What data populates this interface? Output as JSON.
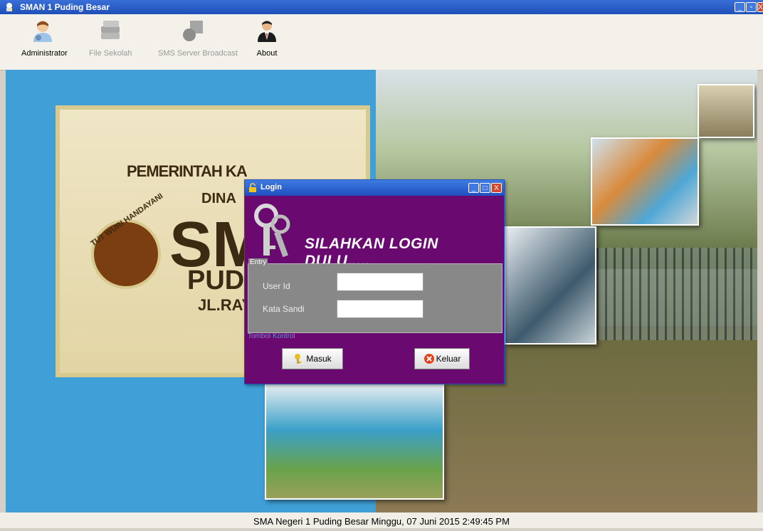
{
  "window": {
    "title": "SMAN 1 Puding Besar"
  },
  "toolbar": {
    "items": [
      {
        "label": "Administrator",
        "icon": "admin-user-icon",
        "enabled": true
      },
      {
        "label": "File Sekolah",
        "icon": "file-stack-icon",
        "enabled": false
      },
      {
        "label": "SMS Server Broadcast",
        "icon": "sms-server-icon",
        "enabled": false
      },
      {
        "label": "About",
        "icon": "person-suit-icon",
        "enabled": true
      }
    ]
  },
  "background": {
    "sign_lines": [
      "PEMERINTAH KA",
      "DINA",
      "SM",
      "PUDIN",
      "JL.RAYA"
    ],
    "emblem_text": "TUT WURI HANDAYANI"
  },
  "login": {
    "title": "Login",
    "headline": "SILAHKAN LOGIN DULU.....",
    "entry_legend": "Entry",
    "user_id_label": "User Id",
    "user_id_value": "",
    "password_label": "Kata Sandi",
    "password_value": "",
    "control_legend": "Tombol Kontrol",
    "login_button": "Masuk",
    "exit_button": "Keluar"
  },
  "status": {
    "text": "SMA Negeri 1 Puding Besar  Minggu, 07 Juni 2015   2:49:45 PM"
  },
  "colors": {
    "dialog_bg": "#6a0a70",
    "titlebar": "#1f4fb8",
    "entry_bg": "#888888"
  }
}
